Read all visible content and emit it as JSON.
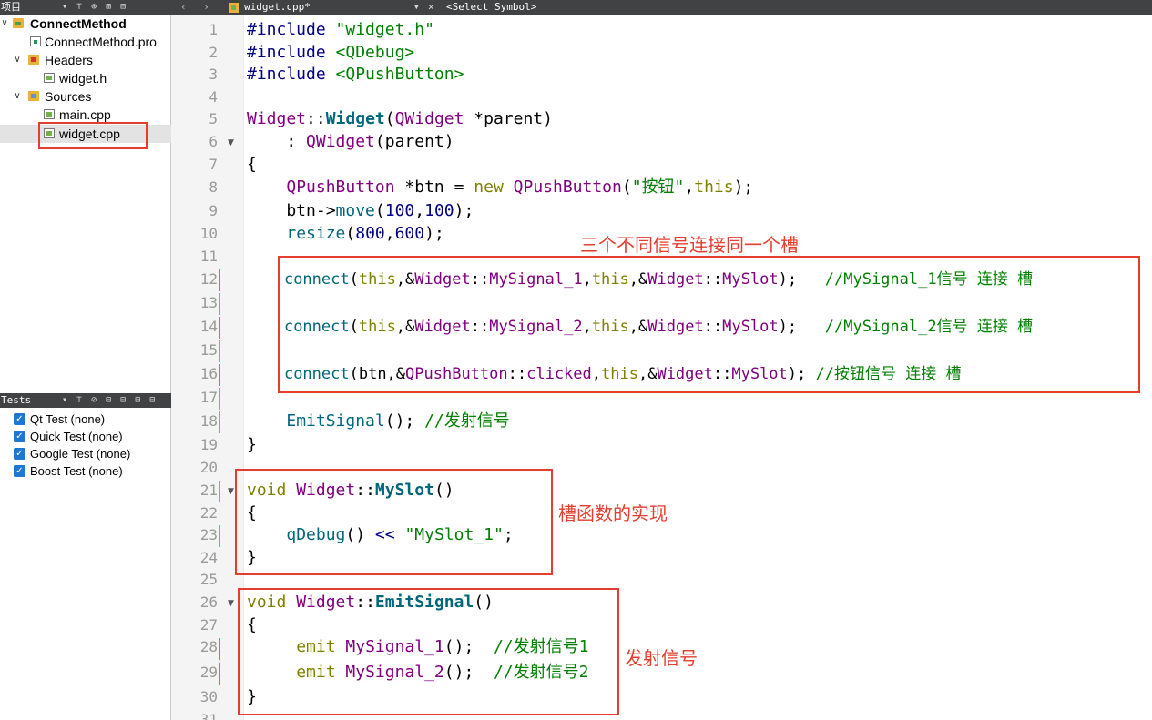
{
  "project_panel": {
    "title": "项目",
    "tools": "▾ ⊤ ⊕ ⊞ ⊟",
    "tree": [
      {
        "label": "ConnectMethod",
        "arrow": "∨",
        "bold": true
      },
      {
        "label": "ConnectMethod.pro"
      },
      {
        "label": "Headers",
        "arrow": "∨"
      },
      {
        "label": "widget.h"
      },
      {
        "label": "Sources",
        "arrow": "∨"
      },
      {
        "label": "main.cpp"
      },
      {
        "label": "widget.cpp",
        "selected": true
      }
    ]
  },
  "tests_panel": {
    "title": "Tests",
    "tools": "▾ ⊤ ⊘ ⊟ ⊟ ⊞ ⊟",
    "items": [
      "Qt Test (none)",
      "Quick Test (none)",
      "Google Test (none)",
      "Boost Test (none)"
    ]
  },
  "editor_bar": {
    "nav": "‹ ›",
    "filename": "widget.cpp*",
    "dropdown": "▾",
    "close": "✕",
    "symbol": "<Select Symbol>"
  },
  "lines": [
    "1",
    "2",
    "3",
    "4",
    "5",
    "6",
    "7",
    "8",
    "9",
    "10",
    "11",
    "12",
    "13",
    "14",
    "15",
    "16",
    "17",
    "18",
    "19",
    "20",
    "21",
    "22",
    "23",
    "24",
    "25",
    "26",
    "27",
    "28",
    "29",
    "30",
    "31"
  ],
  "code": {
    "l1a": "#include ",
    "l1b": "\"widget.h\"",
    "l2a": "#include ",
    "l2b": "<QDebug>",
    "l3a": "#include ",
    "l3b": "<QPushButton>",
    "l5_class": "Widget",
    "l5_sep": "::",
    "l5_fn": "Widget",
    "l5_open": "(",
    "l5_type": "QWidget",
    "l5_rest": " *parent)",
    "l6a": "    : ",
    "l6_type": "QWidget",
    "l6_rest": "(parent)",
    "l7": "{",
    "l8_ind": "    ",
    "l8_type": "QPushButton",
    "l8_mid": " *btn = ",
    "l8_new": "new",
    "l8_sp": " ",
    "l8_type2": "QPushButton",
    "l8_open": "(",
    "l8_str": "\"按钮\"",
    "l8_comma": ",",
    "l8_this": "this",
    "l8_end": ");",
    "l9_ind": "    btn->",
    "l9_fn": "move",
    "l9_open": "(",
    "l9_n1": "100",
    "l9_comma": ",",
    "l9_n2": "100",
    "l9_end": ");",
    "l10_ind": "    ",
    "l10_fn": "resize",
    "l10_open": "(",
    "l10_n1": "800",
    "l10_comma": ",",
    "l10_n2": "600",
    "l10_end": ");",
    "l12_ind": "    ",
    "l12_fn": "connect",
    "l12_open": "(",
    "l12_this": "this",
    "l12_amp": ",&",
    "l12_cls": "Widget",
    "l12_sep": "::",
    "l12_sig": "MySignal_1",
    "l12_c2": ",",
    "l12_this2": "this",
    "l12_amp2": ",&",
    "l12_cls2": "Widget",
    "l12_sep2": "::",
    "l12_slot": "MySlot",
    "l12_end": ");   ",
    "l12_cm": "//MySignal_1信号 连接 槽",
    "l14_ind": "    ",
    "l14_fn": "connect",
    "l14_open": "(",
    "l14_this": "this",
    "l14_amp": ",&",
    "l14_cls": "Widget",
    "l14_sep": "::",
    "l14_sig": "MySignal_2",
    "l14_c2": ",",
    "l14_this2": "this",
    "l14_amp2": ",&",
    "l14_cls2": "Widget",
    "l14_sep2": "::",
    "l14_slot": "MySlot",
    "l14_end": ");   ",
    "l14_cm": "//MySignal_2信号 连接 槽",
    "l16_ind": "    ",
    "l16_fn": "connect",
    "l16_open": "(btn,&",
    "l16_cls": "QPushButton",
    "l16_sep": "::",
    "l16_sig": "clicked",
    "l16_c2": ",",
    "l16_this": "this",
    "l16_amp": ",&",
    "l16_cls2": "Widget",
    "l16_sep2": "::",
    "l16_slot": "MySlot",
    "l16_end": "); ",
    "l16_cm": "//按钮信号 连接 槽",
    "l18_ind": "    ",
    "l18_fn": "EmitSignal",
    "l18_end": "(); ",
    "l18_cm": "//发射信号",
    "l19": "}",
    "l21_kw": "void",
    "l21_sp": " ",
    "l21_cls": "Widget",
    "l21_sep": "::",
    "l21_fn": "MySlot",
    "l21_end": "()",
    "l22": "{",
    "l23_ind": "    ",
    "l23_fn": "qDebug",
    "l23_mid": "() ",
    "l23_op": "<<",
    "l23_sp": " ",
    "l23_str": "\"MySlot_1\"",
    "l23_end": ";",
    "l24": "}",
    "l26_kw": "void",
    "l26_sp": " ",
    "l26_cls": "Widget",
    "l26_sep": "::",
    "l26_fn": "EmitSignal",
    "l26_end": "()",
    "l27": "{",
    "l28_ind": "     ",
    "l28_kw": "emit",
    "l28_sp": " ",
    "l28_sig": "MySignal_1",
    "l28_end": "();  ",
    "l28_cm": "//发射信号1",
    "l29_ind": "     ",
    "l29_kw": "emit",
    "l29_sp": " ",
    "l29_sig": "MySignal_2",
    "l29_end": "();  ",
    "l29_cm": "//发射信号2",
    "l30": "}"
  },
  "annotations": {
    "connect_note": "三个不同信号连接同一个槽",
    "slot_note": "槽函数的实现",
    "emit_note": "发射信号"
  },
  "colors": {
    "annotation_red": "#e53d2e",
    "keyword": "#808000",
    "type": "#800080",
    "string": "#008000",
    "function": "#00677c"
  }
}
